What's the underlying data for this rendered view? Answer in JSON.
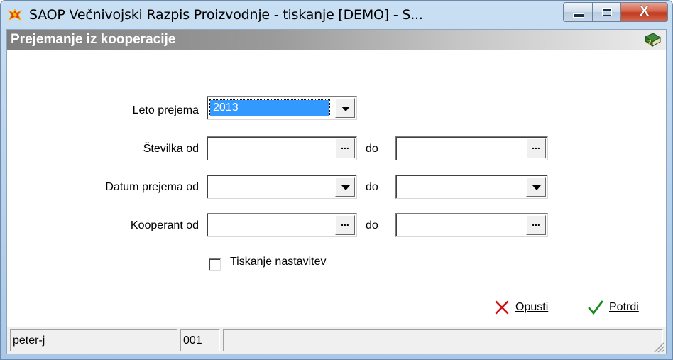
{
  "window": {
    "title": "SAOP   Večnivojski Razpis Proizvodnje - tiskanje [DEMO] - S...",
    "close_glyph": "X"
  },
  "header": {
    "title": "Prejemanje iz kooperacije",
    "help_icon": "help-book-icon"
  },
  "form": {
    "year": {
      "label": "Leto prejema",
      "value": "2013"
    },
    "number": {
      "label": "Številka od",
      "to_label": "do",
      "from_value": "",
      "to_value": "",
      "button_label": "..."
    },
    "date": {
      "label": "Datum prejema od",
      "to_label": "do",
      "from_value": "",
      "to_value": ""
    },
    "cooperant": {
      "label": "Kooperant od",
      "to_label": "do",
      "from_value": "",
      "to_value": "",
      "button_label": "..."
    },
    "print_settings": {
      "label": "Tiskanje nastavitev",
      "checked": false
    }
  },
  "actions": {
    "cancel": {
      "label": "Opusti",
      "icon": "red-x-icon"
    },
    "confirm": {
      "label": "Potrdi",
      "icon": "green-check-icon"
    }
  },
  "status": {
    "user": "peter-j",
    "code": "001",
    "message": ""
  },
  "colors": {
    "selection": "#3399ff",
    "header_gradient_start": "#7e7e7e",
    "cancel_icon": "#cc1111",
    "confirm_icon": "#1a8a1a"
  }
}
